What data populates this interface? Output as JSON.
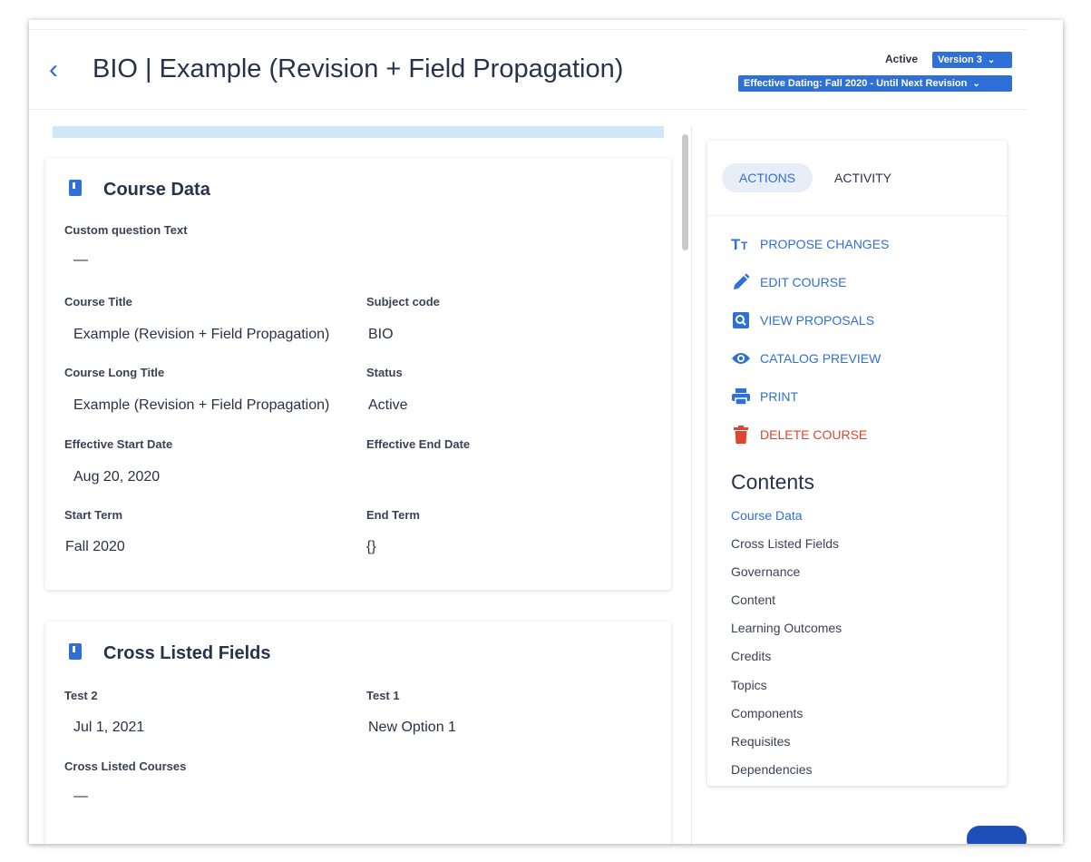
{
  "header": {
    "back_glyph": "‹",
    "title": "BIO | Example (Revision + Field Propagation)",
    "status": "Active",
    "version_label": "Version 3",
    "dating_label": "Effective Dating: Fall 2020 - Until Next Revision"
  },
  "cards": {
    "course_data": {
      "title": "Course Data",
      "custom_question_label": "Custom question Text",
      "custom_question_value": "—",
      "course_title_label": "Course Title",
      "course_title_value": "Example (Revision + Field Propagation)",
      "subject_code_label": "Subject code",
      "subject_code_value": "BIO",
      "long_title_label": "Course Long Title",
      "long_title_value": "Example (Revision + Field Propagation)",
      "status_label": "Status",
      "status_value": "Active",
      "start_date_label": "Effective Start Date",
      "start_date_value": "Aug 20, 2020",
      "end_date_label": "Effective End Date",
      "start_term_label": "Start Term",
      "start_term_value": "Fall 2020",
      "end_term_label": "End Term",
      "end_term_value": "{}"
    },
    "cross_listed": {
      "title": "Cross Listed Fields",
      "test2_label": "Test 2",
      "test2_value": "Jul 1, 2021",
      "test1_label": "Test 1",
      "test1_value": "New Option 1",
      "courses_label": "Cross Listed Courses",
      "courses_value": "—"
    }
  },
  "sidebar": {
    "tabs": {
      "actions": "ACTIONS",
      "activity": "ACTIVITY"
    },
    "actions": {
      "propose": "PROPOSE CHANGES",
      "edit": "EDIT COURSE",
      "view": "VIEW PROPOSALS",
      "preview": "CATALOG PREVIEW",
      "print": "PRINT",
      "delete": "DELETE COURSE"
    },
    "contents_title": "Contents",
    "contents": [
      "Course Data",
      "Cross Listed Fields",
      "Governance",
      "Content",
      "Learning Outcomes",
      "Credits",
      "Topics",
      "Components",
      "Requisites",
      "Dependencies"
    ]
  },
  "colors": {
    "accent": "#2f6fd8",
    "danger": "#e0452f",
    "progress": "#cfe8f8"
  },
  "icons": {
    "propose": "text-size-icon",
    "edit": "pencil-icon",
    "view": "search-box-icon",
    "preview": "eye-icon",
    "print": "printer-icon",
    "delete": "trash-icon",
    "card": "book-icon"
  }
}
